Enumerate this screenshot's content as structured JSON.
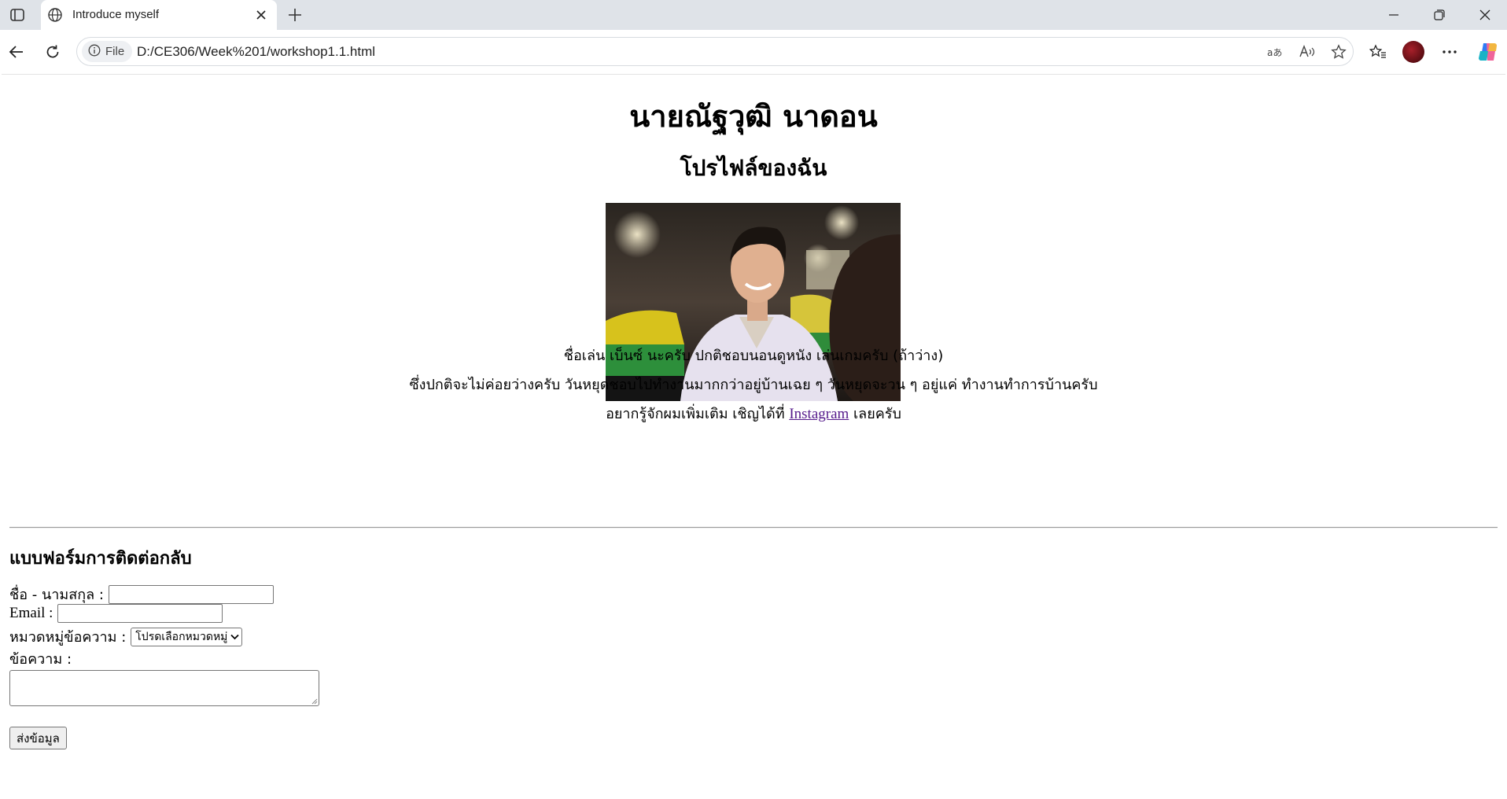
{
  "browser": {
    "tab_title": "Introduce myself",
    "site_chip": "File",
    "url": "D:/CE306/Week%201/workshop1.1.html"
  },
  "page": {
    "name_heading": "นายณัฐวุฒิ นาดอน",
    "profile_heading": "โปรไฟล์ของฉัน",
    "photo_alt": "profile photo",
    "para1": "ชื่อเล่น เบ็นซ์ นะครับ ปกติชอบนอนดูหนัง เล่นเกมครับ (ถ้าว่าง)",
    "para2": "ซึ่งปกติจะไม่ค่อยว่างครับ วันหยุดชอบไปทำงานมากกว่าอยู่บ้านเฉย ๆ วันหยุดจะวน ๆ อยู่แค่ ทำงานทำการบ้านครับ",
    "para3_prefix": "อยากรู้จักผมเพิ่มเติม เชิญได้ที่ ",
    "para3_link": "Instagram",
    "para3_suffix": " เลยครับ"
  },
  "form": {
    "title": "แบบฟอร์มการติดต่อกลับ",
    "name_label": "ชื่อ - นามสกุล :",
    "email_label": "Email :",
    "category_label": "หมวดหมู่ข้อความ :",
    "category_selected": "โปรดเลือกหมวดหมู่",
    "message_label": "ข้อความ :",
    "submit_label": "ส่งข้อมูล"
  }
}
